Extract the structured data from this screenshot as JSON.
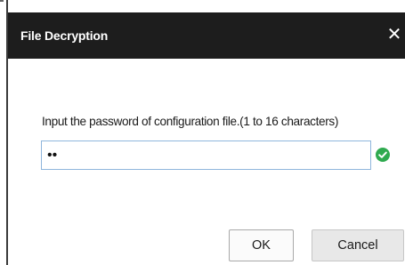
{
  "dialog": {
    "title": "File Decryption",
    "close_symbol": "✕",
    "prompt": "Input the password of configuration file.(1 to 16 characters)",
    "password": {
      "value": "12",
      "type": "password",
      "valid_icon": "check-circle-icon",
      "valid_color": "#2faa4f"
    },
    "buttons": {
      "ok": "OK",
      "cancel": "Cancel"
    }
  },
  "colors": {
    "titlebar": "#1d1d1d",
    "input_border": "#8fb6dc"
  }
}
